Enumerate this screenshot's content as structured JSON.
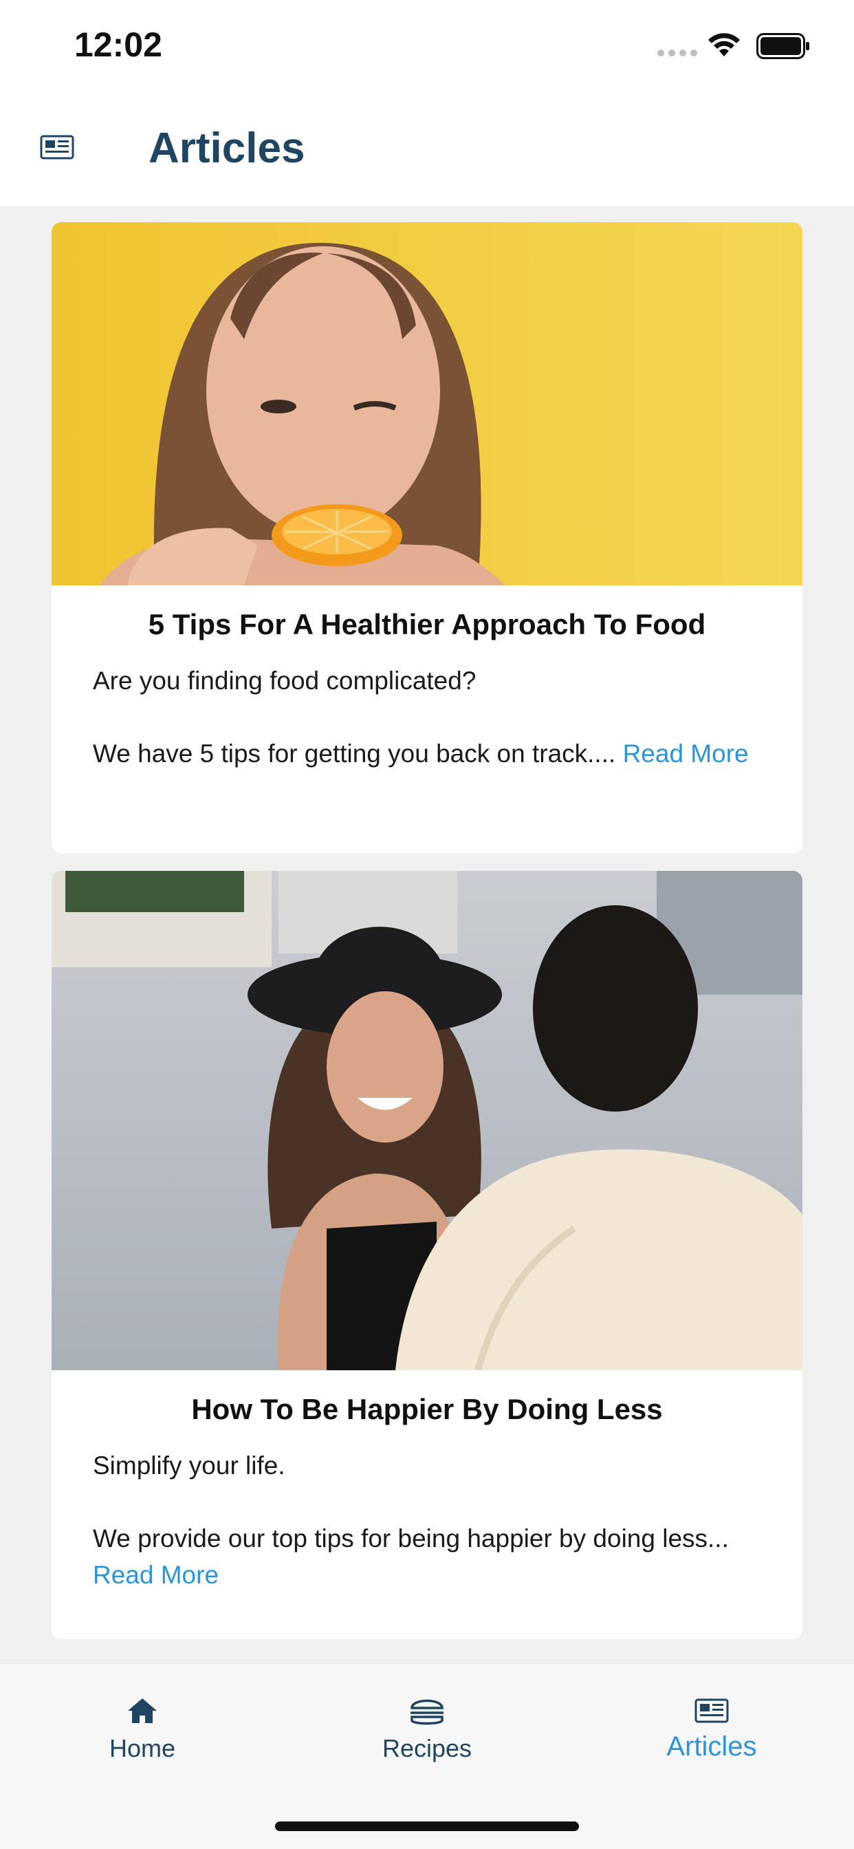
{
  "status_bar": {
    "time": "12:02"
  },
  "header": {
    "title": "Articles",
    "icon": "newspaper-icon"
  },
  "articles": [
    {
      "title": "5 Tips For A Healthier Approach To Food",
      "intro": "Are you finding food complicated?",
      "body": "We have 5 tips for getting you back on track.... ",
      "read_more": "Read More"
    },
    {
      "title": "How To Be Happier By Doing Less",
      "intro": "Simplify your life.",
      "body": "We provide our top tips for being happier by doing less... ",
      "read_more": "Read More"
    }
  ],
  "tab_bar": {
    "tabs": [
      {
        "label": "Home",
        "icon": "home-icon"
      },
      {
        "label": "Recipes",
        "icon": "burger-icon"
      },
      {
        "label": "Articles",
        "icon": "newspaper-icon",
        "active": true
      }
    ]
  },
  "colors": {
    "header_title": "#1f4563",
    "link": "#2a94d8",
    "background": "#f0f0f0"
  }
}
